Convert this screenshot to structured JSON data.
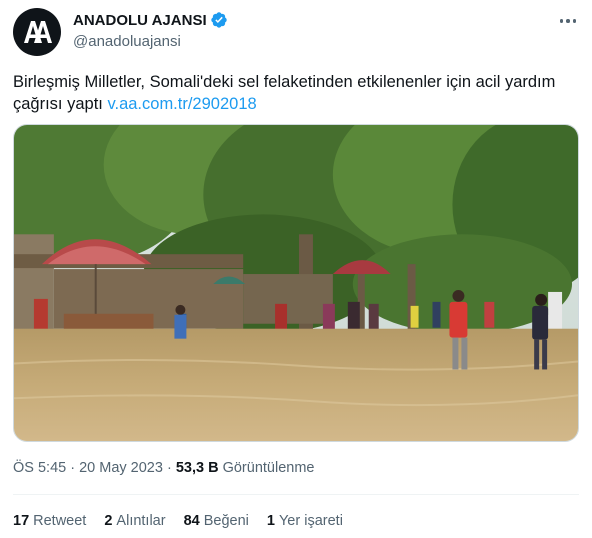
{
  "author": {
    "display_name": "ANADOLU AJANSI",
    "handle": "@anadoluajansi",
    "avatar_text": "AA",
    "verified_icon": "verified-badge-icon"
  },
  "tweet": {
    "text": "Birleşmiş Milletler, Somali'deki sel felaketinden etkilenenler için acil yardım çağrısı yaptı ",
    "link": "v.aa.com.tr/2902018",
    "media_icon": "flooded-street-photo"
  },
  "meta": {
    "time": "ÖS 5:45",
    "sep1": " · ",
    "date": "20 May 2023",
    "sep2": " · ",
    "views_count": "53,3 B",
    "views_label": " Görüntülenme"
  },
  "stats": {
    "retweets_count": "17",
    "retweets_label": "Retweet",
    "quotes_count": "2",
    "quotes_label": "Alıntılar",
    "likes_count": "84",
    "likes_label": "Beğeni",
    "bookmarks_count": "1",
    "bookmarks_label": "Yer işareti"
  },
  "colors": {
    "link": "#1d9bf0",
    "secondary_text": "#536471",
    "verified": "#1d9bf0"
  }
}
